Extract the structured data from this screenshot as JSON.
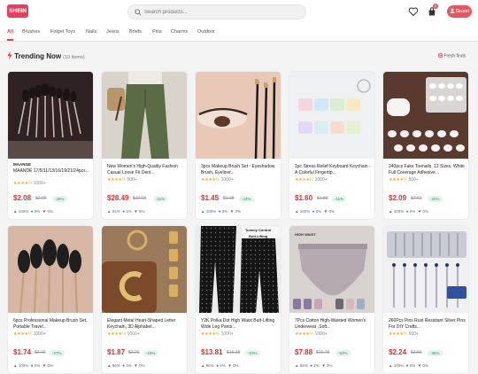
{
  "header": {
    "logo_text": "SHEIN",
    "search_placeholder": "Search products...",
    "cart_count": "0",
    "guest_label": "Guest"
  },
  "tabs": [
    "All",
    "Brushes",
    "Fidget Toys",
    "Nails",
    "Jeans",
    "Briefs",
    "Pins",
    "Charms",
    "Outdoor"
  ],
  "section": {
    "title": "Trending Now",
    "count": "(10 items)",
    "fresh": "Fresh finds"
  },
  "products": [
    {
      "title_caps": "MAANGE",
      "title": "MAANDE 17/5/11/13/16/19/21/24pcs...",
      "stars": "★★★★½",
      "reviews": "1000+",
      "price": "$2.08",
      "old": "$2.99",
      "disc": "-26%",
      "s1": "100%",
      "s2": "0%",
      "s3": "0%"
    },
    {
      "title": "New Women's High-Quality Fashion Casual Loose Fit Deni...",
      "stars": "★★★★½",
      "reviews": "500+",
      "price": "$28.49",
      "old": "$32.09",
      "disc": "-11%",
      "s1": "91%",
      "s2": "4%",
      "s3": "5%"
    },
    {
      "title": "3pcs Makeup Brush Set - Eyeshadow Brush, Eyeliner...",
      "stars": "★★★★½",
      "reviews": "1000+",
      "price": "$1.45",
      "old": "$1.98",
      "disc": "-24%",
      "s1": "100%",
      "s2": "0%",
      "s3": "0%"
    },
    {
      "title": "1pc Stress Relief Keyboard Keychain - A Colorful Fingertip...",
      "stars": "★★★★½",
      "reviews": "1000+",
      "price": "$1.60",
      "old": "$1.80",
      "disc": "-11%",
      "s1": "100%",
      "s2": "0%",
      "s3": "0%"
    },
    {
      "title": "240pcs Fake Toenails, 12 Sizes, White Full Coverage Adhesive...",
      "stars": "★★★★½",
      "reviews": "500+",
      "price": "$2.09",
      "old": "$2.61",
      "disc": "-20%",
      "s1": "100%",
      "s2": "0%",
      "s3": "0%"
    },
    {
      "title": "6pcs Professional Makeup Brush Set, Portable Travel...",
      "stars": "★★★★½",
      "reviews": "1000+",
      "price": "$1.74",
      "old": "$2.09",
      "disc": "-27%",
      "s1": "100%",
      "s2": "0%",
      "s3": "0%"
    },
    {
      "title": "Elegant Metal Heart-Shaped Letter Keychain, 3D Alphabet...",
      "stars": "★★★★½",
      "reviews": "1000+",
      "price": "$1.87",
      "old": "$2.20",
      "disc": "-15%",
      "s1": "96%",
      "s2": "4%",
      "s3": "0%"
    },
    {
      "title": "Y2K Polka Dot High Waist Butt-Lifting Wide Leg Pants...",
      "stars": "★★★★½",
      "reviews": "1000+",
      "price": "$13.81",
      "old": "$15.18",
      "disc": "-10%",
      "s1": "96%",
      "s2": "4%",
      "s3": "0%"
    },
    {
      "title": "7Pcs Cotton High-Waisted Women's Underwear ,Soft...",
      "stars": "★★★★½",
      "reviews": "1000+",
      "price": "$7.88",
      "old": "$16.78",
      "disc": "-53%",
      "s1": "95%",
      "s2": "2%",
      "s3": "3%"
    },
    {
      "title": "260Pcs Pins Rust Resistant Silver Pins For DIY Crafts...",
      "stars": "★★★★½",
      "reviews": "500+",
      "price": "$2.24",
      "old": "$3.56",
      "disc": "-36%",
      "s1": "100%",
      "s2": "0%",
      "s3": "0%"
    }
  ],
  "image_labels": {
    "tummy": "Tummy Control",
    "butt": "Butt Lifting",
    "waist": "HIGH WAIST"
  },
  "colors": {
    "accent": "#e83e5c",
    "price": "#e02d2d",
    "discount": "#1a9e56"
  }
}
